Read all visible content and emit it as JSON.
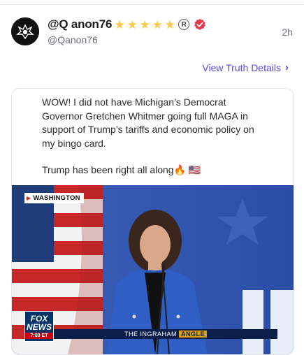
{
  "post": {
    "display_name": "@Q anon76",
    "handle": "@Qanon76",
    "timestamp": "2h",
    "badges": {
      "stars": [
        "★",
        "★",
        "★",
        "★",
        "★"
      ],
      "registered": "R"
    },
    "view_details": "View Truth Details",
    "paragraph_1": "WOW! I did not have Michigan’s Democrat Governor Gretchen Whitmer going full MAGA in support of Trump’s tariffs and economic policy on my bingo card.",
    "paragraph_2": "Trump has been right all along🔥 🇺🇸"
  },
  "media": {
    "location": "WASHINGTON",
    "network": "FOX",
    "network_sub": "NEWS",
    "time": "7:00 ET",
    "show_prefix": "THE INGRAHAM",
    "show_suffix": "ANGLE"
  },
  "colors": {
    "accent": "#5a4bd8",
    "verified": "#e8394b",
    "star": "#f7c948"
  }
}
